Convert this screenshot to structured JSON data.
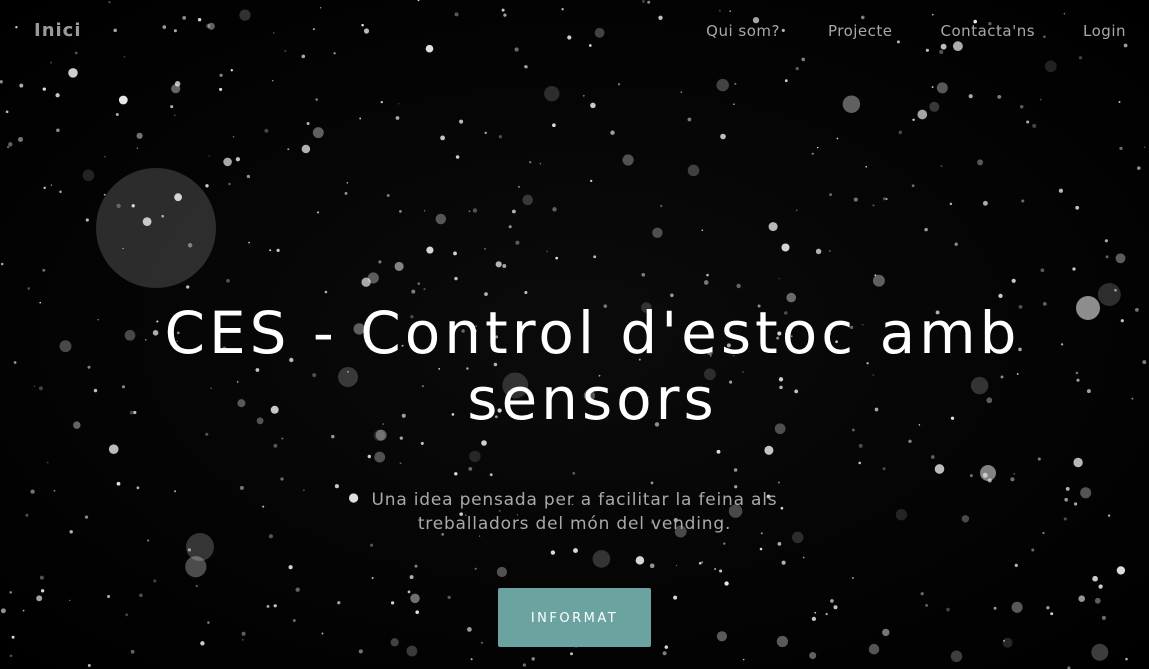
{
  "navbar": {
    "brand": "Inici",
    "links": [
      {
        "label": "Qui som?"
      },
      {
        "label": "Projecte"
      },
      {
        "label": "Contacta'ns"
      },
      {
        "label": "Login"
      }
    ]
  },
  "hero": {
    "title": "CES - Control d'estoc amb sensors",
    "subtitle": "Una idea pensada per a facilitar la feina als treballadors del món del vending.",
    "cta_label": "INFORMAT"
  },
  "colors": {
    "accent": "#6aa39f",
    "background": "#000000",
    "nav_text": "#a8a8a8",
    "title_text": "#ffffff"
  }
}
